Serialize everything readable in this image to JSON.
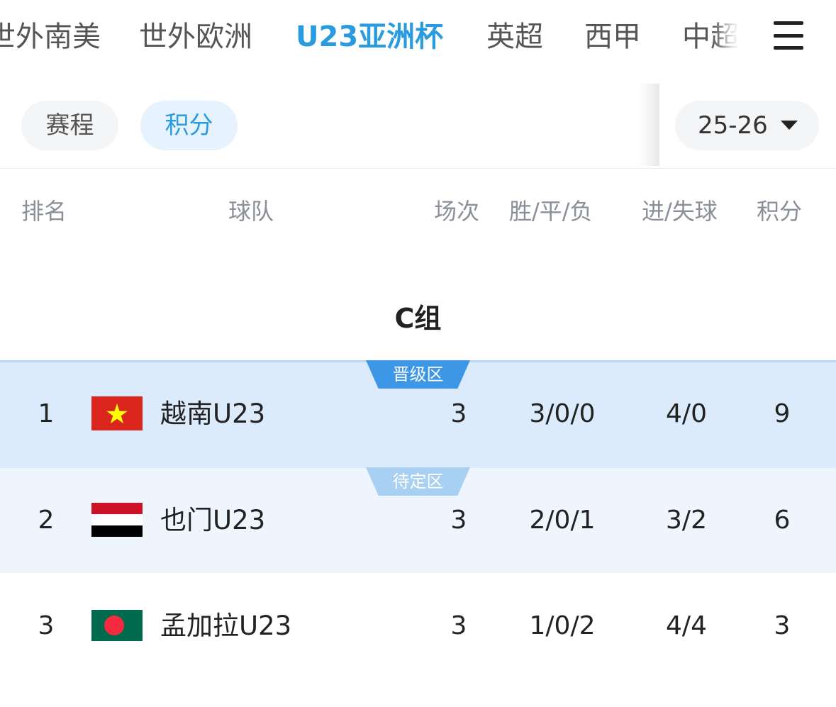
{
  "league_tabs": [
    {
      "label": "世外南美",
      "active": false
    },
    {
      "label": "世外欧洲",
      "active": false
    },
    {
      "label": "U23亚洲杯",
      "active": true
    },
    {
      "label": "英超",
      "active": false
    },
    {
      "label": "西甲",
      "active": false
    },
    {
      "label": "中超",
      "active": false
    }
  ],
  "menu_icon": "hamburger-menu-icon",
  "sub_tabs": [
    {
      "label": "赛程",
      "active": false
    },
    {
      "label": "积分",
      "active": true
    }
  ],
  "season": {
    "value": "25-26",
    "icon": "caret-down-icon"
  },
  "table_headers": {
    "rank": "排名",
    "team": "球队",
    "played": "场次",
    "wdl": "胜/平/负",
    "goals": "进/失球",
    "points": "积分"
  },
  "group_title": "C组",
  "zones": {
    "promote": "晋级区",
    "pending": "待定区"
  },
  "standings": [
    {
      "rank": "1",
      "team": "越南U23",
      "flag": "vietnam-flag-icon",
      "played": "3",
      "wdl": "3/0/0",
      "goals": "4/0",
      "points": "9"
    },
    {
      "rank": "2",
      "team": "也门U23",
      "flag": "yemen-flag-icon",
      "played": "3",
      "wdl": "2/0/1",
      "goals": "3/2",
      "points": "6"
    },
    {
      "rank": "3",
      "team": "孟加拉U23",
      "flag": "bangladesh-flag-icon",
      "played": "3",
      "wdl": "1/0/2",
      "goals": "4/4",
      "points": "3"
    }
  ],
  "colors": {
    "accent": "#2b9be0",
    "promote_row": "#dcebfb",
    "pending_row": "#eef5fd",
    "promote_tag": "#3d97e6",
    "pending_tag": "#a8d0f3"
  }
}
